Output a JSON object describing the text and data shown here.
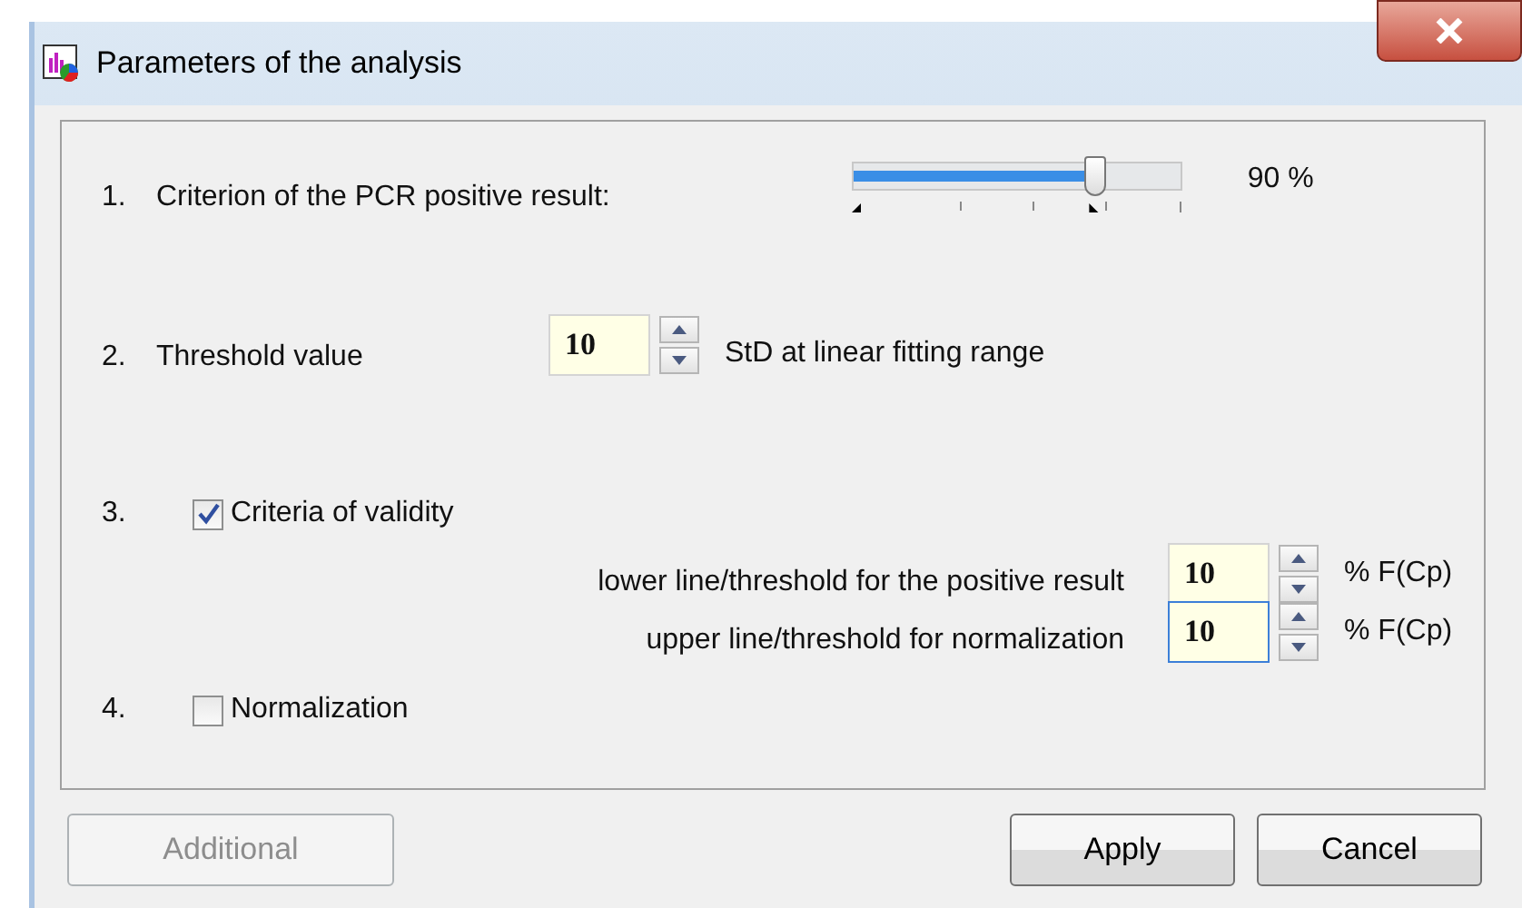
{
  "window": {
    "title": "Parameters of the analysis"
  },
  "criterion": {
    "number": "1.",
    "label": "Criterion of the PCR positive result:",
    "level": 0.74,
    "reading": "90 %"
  },
  "threshold": {
    "number": "2.",
    "label": "Threshold value",
    "value": "10",
    "unit": "StD at linear fitting range"
  },
  "validity": {
    "number": "3.",
    "label": "Criteria of validity",
    "checked": true,
    "fields": [
      {
        "label": "lower line/threshold for the positive result",
        "value": "10",
        "unit": "% F(Cp)",
        "focused": false
      },
      {
        "label": "upper line/threshold for normalization",
        "value": "10",
        "unit": "% F(Cp)",
        "focused": true
      }
    ]
  },
  "normalization": {
    "number": "4.",
    "label": "Normalization",
    "checked": false
  },
  "buttons": [
    {
      "label": "Additional",
      "disabled": true
    },
    {
      "label": "Apply",
      "disabled": false
    },
    {
      "label": "Cancel",
      "disabled": false
    }
  ]
}
